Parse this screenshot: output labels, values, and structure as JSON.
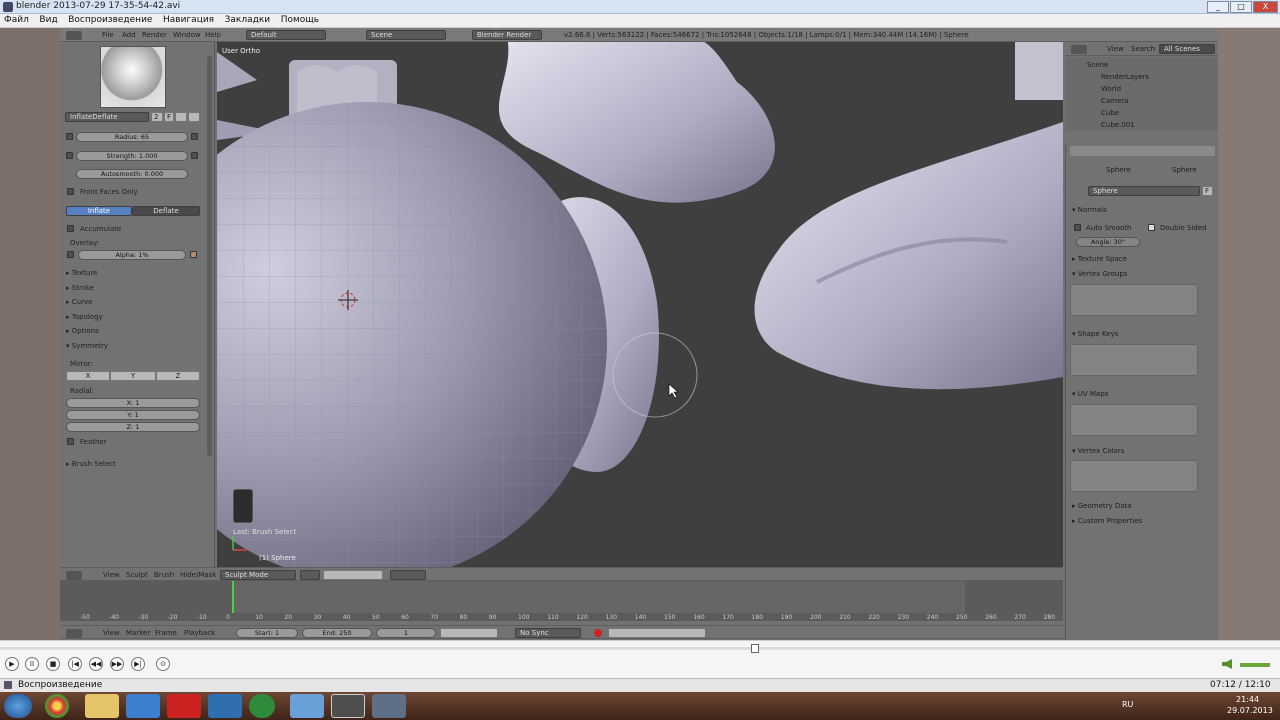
{
  "window": {
    "title": "blender 2013-07-29 17-35-54-42.avi",
    "min": "_",
    "max": "□",
    "close": "X"
  },
  "player_menu": [
    "Файл",
    "Вид",
    "Воспроизведение",
    "Навигация",
    "Закладки",
    "Помощь"
  ],
  "info_header": {
    "menus": [
      "File",
      "Add",
      "Render",
      "Window",
      "Help"
    ],
    "layout": "Default",
    "scene": "Scene",
    "engine": "Blender Render",
    "stats": "v2.66.6 | Verts:563122 | Faces:546672 | Tris:1052648 | Objects:1/18 | Lamps:0/1 | Mem:340.44M (14.16M) | Sphere"
  },
  "tool_shelf": {
    "brush_name": "InflateDeflate",
    "brush_users": "2",
    "brush_f": "F",
    "radius": "Radius: 65",
    "strength": "Strength: 1.000",
    "autosmooth": "Autosmooth: 0.000",
    "front_faces": "Front Faces Only",
    "inflate": "Inflate",
    "deflate": "Deflate",
    "accumulate": "Accumulate",
    "overlay": "Overlay:",
    "alpha": "Alpha: 1%",
    "sections": [
      "Texture",
      "Stroke",
      "Curve",
      "Topology",
      "Options"
    ],
    "symmetry": "Symmetry",
    "mirror": "Mirror:",
    "mirror_axes": [
      "X",
      "Y",
      "Z"
    ],
    "radial": "Radial:",
    "radial_vals": [
      "X: 1",
      "Y: 1",
      "Z: 1"
    ],
    "feather": "Feather",
    "brush_select": "Brush Select"
  },
  "viewport": {
    "view_label": "User Ortho",
    "last_op": "Last: Brush Select",
    "object_label": "(1) Sphere"
  },
  "viewport_header": {
    "menus": [
      "View",
      "Sculpt",
      "Brush",
      "Hide/Mask"
    ],
    "mode": "Sculpt Mode"
  },
  "outliner": {
    "menus": [
      "View",
      "Search"
    ],
    "filter": "All Scenes",
    "items": [
      "Scene",
      "RenderLayers",
      "World",
      "Camera",
      "Cube",
      "Cube.001"
    ]
  },
  "properties": {
    "crumbs": [
      "Sphere",
      "Sphere"
    ],
    "data_name": "Sphere",
    "data_f": "F",
    "normals": "Normals",
    "auto_smooth": "Auto Smooth",
    "double_sided": "Double Sided",
    "angle": "Angle: 30°",
    "texture_space": "Texture Space",
    "vertex_groups": "Vertex Groups",
    "shape_keys": "Shape Keys",
    "uv_maps": "UV Maps",
    "vertex_colors": "Vertex Colors",
    "geometry_data": "Geometry Data",
    "custom_properties": "Custom Properties"
  },
  "timeline": {
    "ticks": [
      "-50",
      "-40",
      "-30",
      "-20",
      "-10",
      "0",
      "10",
      "20",
      "30",
      "40",
      "50",
      "60",
      "70",
      "80",
      "90",
      "100",
      "110",
      "120",
      "130",
      "140",
      "150",
      "160",
      "170",
      "180",
      "190",
      "200",
      "210",
      "220",
      "230",
      "240",
      "250",
      "260",
      "270",
      "280"
    ],
    "menus": [
      "View",
      "Marker",
      "Frame",
      "Playback"
    ],
    "start": "Start: 1",
    "end": "End: 250",
    "current": "1",
    "sync": "No Sync"
  },
  "player_controls": {
    "play": "▶",
    "pause": "II",
    "stop": "■",
    "prev": "|◀",
    "rew": "◀◀",
    "fwd": "▶▶",
    "next": "▶|",
    "frame": "⊙"
  },
  "status": {
    "label": "Воспроизведение",
    "time": "07:12 / 12:10"
  },
  "taskbar": {
    "lang": "RU",
    "clock_time": "21:44",
    "clock_date": "29.07.2013"
  },
  "colors": {
    "accent": "#5680c2",
    "viewport_bg": "#3f3f3f",
    "mesh": "#a9a7bb",
    "panel": "#727272"
  }
}
